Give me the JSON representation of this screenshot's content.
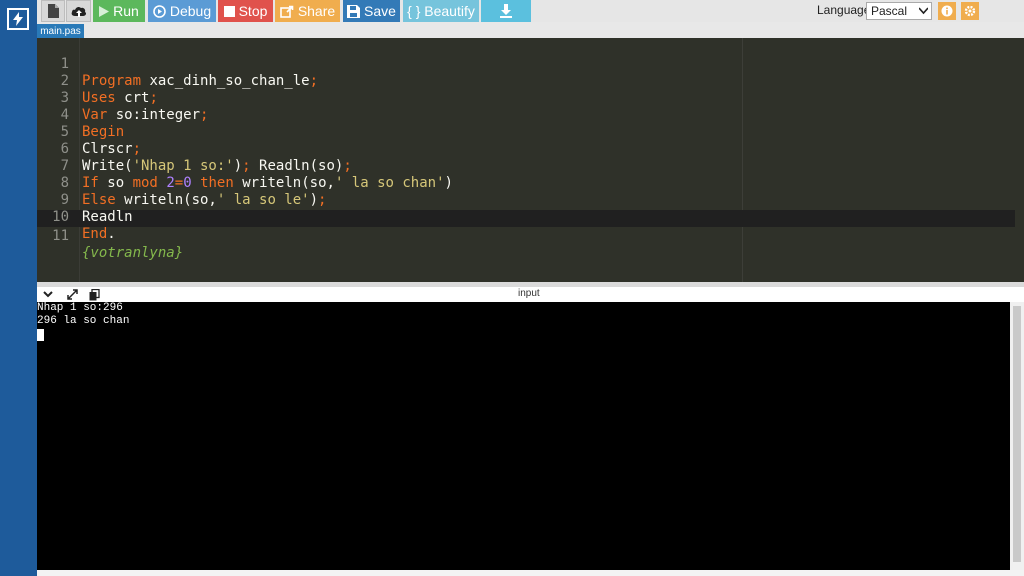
{
  "toolbar": {
    "new_icon": "file-icon",
    "upload_icon": "cloud-upload-icon",
    "run_label": "Run",
    "debug_label": "Debug",
    "stop_label": "Stop",
    "share_label": "Share",
    "save_label": "Save",
    "beautify_label": "{ } Beautify",
    "download_icon": "download-icon",
    "language_label": "Language",
    "language_value": "Pascal",
    "info_icon": "info-icon",
    "settings_icon": "gear-icon"
  },
  "tab": {
    "label": "main.pas"
  },
  "editor": {
    "lines": [
      {
        "n": "1",
        "t": "Program xac_dinh_so_chan_le;"
      },
      {
        "n": "2",
        "t": "Uses crt;"
      },
      {
        "n": "3",
        "t": "Var so:integer;"
      },
      {
        "n": "4",
        "t": "Begin"
      },
      {
        "n": "5",
        "t": "Clrscr;"
      },
      {
        "n": "6",
        "t": "Write('Nhap 1 so:'); Readln(so);"
      },
      {
        "n": "7",
        "t": "If so mod 2=0 then writeln(so,' la so chan')"
      },
      {
        "n": "8",
        "t": "Else writeln(so,' la so le');"
      },
      {
        "n": "9",
        "t": "Readln"
      },
      {
        "n": "10",
        "t": "End."
      },
      {
        "n": "11",
        "t": "{votranlyna}"
      }
    ]
  },
  "console_bar": {
    "collapse_icon": "chevron-down-icon",
    "expand_icon": "expand-icon",
    "copy_icon": "copy-icon",
    "input_label": "input"
  },
  "console": {
    "lines": [
      "Nhap 1 so:296",
      "296 la so chan"
    ]
  },
  "colors": {
    "sidebar": "#1e5b9b",
    "run": "#5cb85c",
    "debug": "#5b9bd5",
    "stop": "#e0524c",
    "share": "#f0ad4e",
    "save": "#337ab7",
    "beautify": "#76c4dc",
    "download": "#5bc0de",
    "editor_bg": "#2f3129",
    "console_bg": "#000000"
  }
}
